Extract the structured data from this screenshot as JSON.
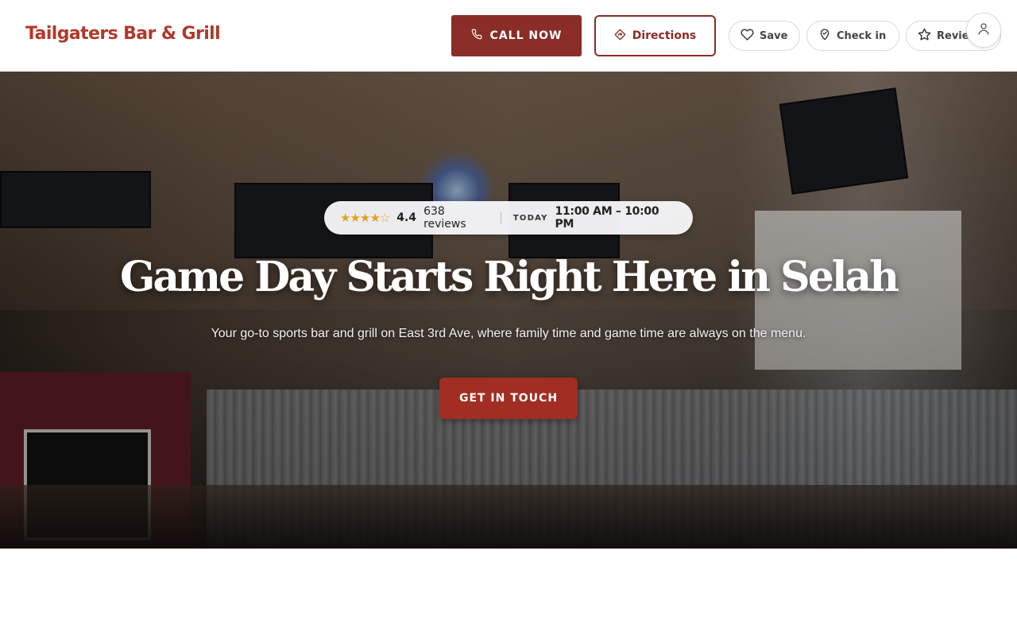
{
  "header": {
    "brand": "Tailgaters Bar & Grill",
    "call_label": "CALL NOW",
    "directions_label": "Directions",
    "actions": [
      {
        "label": "Save",
        "icon": "heart-icon"
      },
      {
        "label": "Check in",
        "icon": "map-pin-icon"
      },
      {
        "label": "Reviews",
        "icon": "star-icon"
      }
    ],
    "account_icon": "user-icon"
  },
  "hero": {
    "rating": {
      "stars_display": "★★★★☆",
      "score": "4.4",
      "reviews": "638 reviews",
      "today_label": "TODAY",
      "hours": "11:00 AM – 10:00 PM"
    },
    "title": "Game Day Starts Right Here in Selah",
    "subtitle": "Your go-to sports bar and grill on East 3rd Ave, where family time and game time are always on the menu.",
    "cta_label": "GET IN TOUCH"
  },
  "colors": {
    "brand": "#b0392a",
    "primary_button": "#8a2c27",
    "cta": "#a22d22",
    "star": "#e3a11b"
  }
}
